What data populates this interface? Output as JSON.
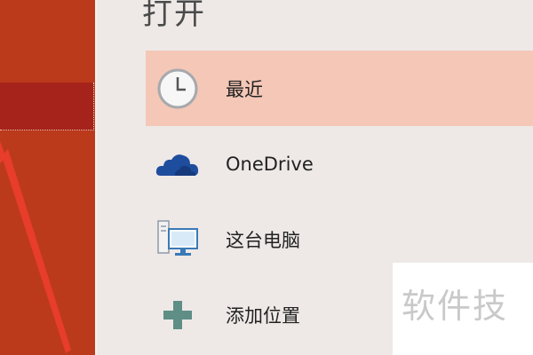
{
  "page_title": "打开",
  "locations": [
    {
      "label": "最近",
      "icon": "clock-icon",
      "selected": true
    },
    {
      "label": "OneDrive",
      "icon": "cloud-icon",
      "selected": false
    },
    {
      "label": "这台电脑",
      "icon": "computer-icon",
      "selected": false
    },
    {
      "label": "添加位置",
      "icon": "plus-icon",
      "selected": false
    }
  ],
  "watermark": "软件技",
  "colors": {
    "sidebar": "#bc3a1c",
    "sidebar_selected": "#a5231a",
    "selected_row": "#f4c7b7",
    "onedrive_blue": "#1f4d9e",
    "plus_teal": "#5e8e86",
    "annotation_arrow": "#e73d2a"
  }
}
